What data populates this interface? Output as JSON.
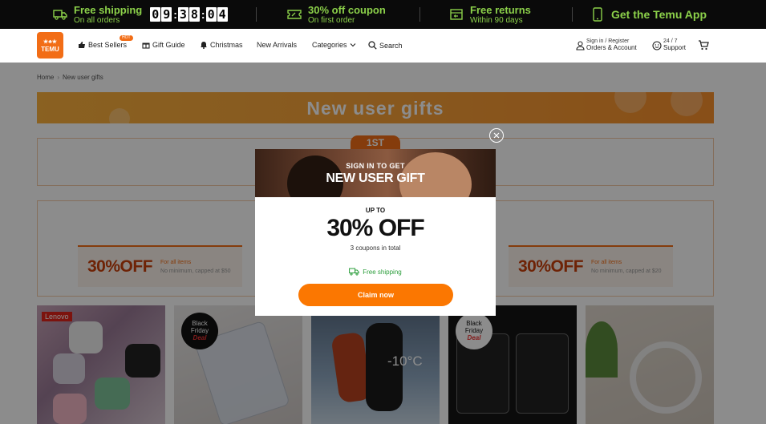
{
  "topbar": {
    "free_shipping": {
      "title": "Free shipping",
      "sub": "On all orders"
    },
    "timer": {
      "h": [
        "0",
        "9"
      ],
      "m": [
        "3",
        "8"
      ],
      "s": [
        "0",
        "4"
      ]
    },
    "coupon": {
      "title": "30% off coupon",
      "sub": "On first order"
    },
    "returns": {
      "title": "Free returns",
      "sub": "Within 90 days"
    },
    "app": {
      "title": "Get the Temu App"
    },
    "colors": {
      "bg": "#0a0a0a",
      "accent": "#8cd14a"
    }
  },
  "nav": {
    "logo_top": "★♣★",
    "logo_text": "TEMU",
    "best_sellers": "Best Sellers",
    "best_sellers_badge": "HOT",
    "gift_guide": "Gift Guide",
    "christmas": "Christmas",
    "new_arrivals": "New Arrivals",
    "categories": "Categories",
    "search": "Search",
    "account_line1": "Sign in / Register",
    "account_line2": "Orders & Account",
    "support_line1": "24 / 7",
    "support_line2": "Support",
    "brand_color": "#f26d16"
  },
  "breadcrumb": {
    "home": "Home",
    "sep": "›",
    "current": "New user gifts"
  },
  "banner": {
    "title": "New user gifts"
  },
  "tab_label": "1ST",
  "coupons": [
    {
      "amount": "30%OFF",
      "line1": "For all items",
      "line2": "No minimum, capped at $50"
    },
    {
      "amount": "30%OFF",
      "line1": "For all items",
      "line2": "No minimum, capped at $20"
    }
  ],
  "products": [
    {
      "badge": "Lenovo"
    },
    {
      "badge_line1": "Black",
      "badge_line2": "Friday",
      "badge_line3": "Deal"
    },
    {
      "label": "-10°C"
    },
    {
      "badge_line1": "Black",
      "badge_line2": "Friday",
      "badge_line3": "Deal"
    },
    {}
  ],
  "modal": {
    "hero_sub": "SIGN IN TO GET",
    "hero_title": "NEW USER GIFT",
    "upto": "UP TO",
    "percent": "30% OFF",
    "count": "3 coupons in total",
    "free_shipping": "Free shipping",
    "claim": "Claim now",
    "claim_color": "#fb7701"
  }
}
